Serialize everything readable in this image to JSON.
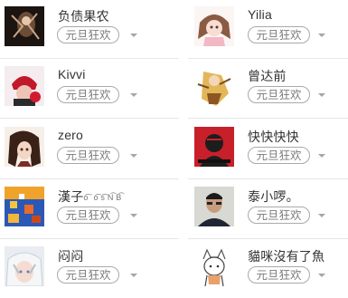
{
  "members": [
    {
      "name": "负债果农",
      "tag": "元旦狂欢",
      "avatar": "dark-figure-avatar"
    },
    {
      "name": "Kivvi",
      "tag": "元旦狂欢",
      "avatar": "red-hat-avatar"
    },
    {
      "name": "zero",
      "tag": "元旦狂欢",
      "avatar": "anime-girl-avatar"
    },
    {
      "name": "漢子",
      "name_suffix": "o͡ ˙o͡ s͡ N͡ B͡",
      "tag": "元旦狂欢",
      "avatar": "pixel-scene-avatar"
    },
    {
      "name": "闷闷",
      "name_suffix": "",
      "tag": "元旦狂欢",
      "avatar": "white-hair-avatar"
    },
    {
      "name": "Yilia",
      "tag": "元旦狂欢",
      "avatar": "cute-girl-avatar"
    },
    {
      "name": "曾达前",
      "tag": "元旦狂欢",
      "avatar": "golden-figure-avatar"
    },
    {
      "name": "快快快快",
      "tag": "元旦狂欢",
      "avatar": "red-poster-avatar"
    },
    {
      "name": "泰小啰。",
      "tag": "元旦狂欢",
      "avatar": "man-photo-avatar"
    },
    {
      "name": "貓咪沒有了魚",
      "tag": "元旦狂欢",
      "avatar": "cat-girl-avatar"
    }
  ],
  "colors": {
    "tag_border": "#a9a9a9",
    "tag_text": "#7a7a7a",
    "separator": "#e6e6e6",
    "caret": "#a6a6a6"
  }
}
